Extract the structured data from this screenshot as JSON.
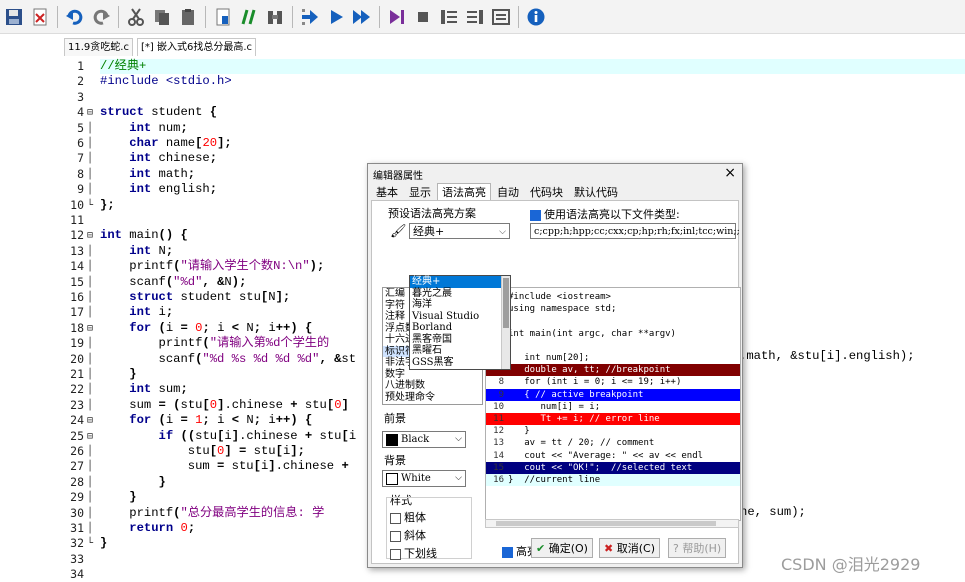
{
  "toolbar": {
    "icons": [
      "save-icon",
      "close-file-icon",
      "undo-icon",
      "redo-icon",
      "cut-icon",
      "copy-icon",
      "paste-icon",
      "new-file-icon",
      "comment-icon",
      "find-icon",
      "compile-icon",
      "run-icon",
      "compile-run-icon",
      "debug-icon",
      "stop-icon",
      "indent-icon",
      "unindent-icon",
      "format-icon",
      "about-icon"
    ],
    "colors": {
      "blue": "#1560bd",
      "green": "#1a8d2b",
      "purple": "#7a2f9a",
      "gray": "#555555",
      "red": "#cc2222"
    }
  },
  "tabs": [
    {
      "label": "11.9贪吃蛇.c"
    },
    {
      "label": "[*] 嵌入式6找总分最高.c"
    }
  ],
  "editor": {
    "line_numbers": [
      "1",
      "2",
      "3",
      "4",
      "5",
      "6",
      "7",
      "8",
      "9",
      "10",
      "11",
      "12",
      "13",
      "14",
      "15",
      "16",
      "17",
      "18",
      "19",
      "20",
      "21",
      "22",
      "23",
      "24",
      "25",
      "26",
      "27",
      "28",
      "29",
      "30",
      "31",
      "32",
      "33",
      "34"
    ],
    "current_line": 1,
    "lines": [
      "//经典+",
      "#include <stdio.h>",
      "",
      "struct student {",
      "    int num;",
      "    char name[20];",
      "    int chinese;",
      "    int math;",
      "    int english;",
      "};",
      "",
      "int main() {",
      "    int N;",
      "    printf(\"请输入学生个数N:\\n\");",
      "    scanf(\"%d\", &N);",
      "    struct student stu[N];",
      "    int i;",
      "    for (i = 0; i < N; i++) {",
      "        printf(\"请输入第%d个学生的",
      "        scanf(\"%d %s %d %d %d\", &st",
      "    }",
      "    int sum;",
      "    sum = (stu[0].chinese + stu[0]",
      "    for (i = 1; i < N; i++) {",
      "        if ((stu[i].chinese + stu[i",
      "            stu[0] = stu[i];",
      "            sum = stu[i].chinese +",
      "        }",
      "    }",
      "    printf(\"总分最高学生的信息: 学",
      "    return 0;",
      "}",
      "",
      ""
    ],
    "right_fragments": {
      "line20": ".math, &stu[i].english);",
      "line30": "ne, sum);"
    }
  },
  "dialog": {
    "title": "编辑器属性",
    "close": "×",
    "tabs": [
      "基本",
      "显示",
      "语法高亮",
      "自动",
      "代码块",
      "默认代码"
    ],
    "active_tab": "语法高亮",
    "preset_label": "预设语法高亮方案",
    "use_highlight_label": "使用语法高亮以下文件类型:",
    "file_types": "c;cpp;h;hpp;cc;cxx;cp;hp;rh;fx;inl;tcc;win;;",
    "scheme_selected": "经典+",
    "scheme_options": [
      "经典+",
      "暮光之晨",
      "海洋",
      "Visual Studio",
      "Borland",
      "黑客帝国",
      "黑曜石",
      "GSS黑客"
    ],
    "elements": [
      "汇编",
      "字符",
      "注释",
      "浮点数",
      "十六进制",
      "标识符",
      "非法字符",
      "数字",
      "八进制数",
      "预处理命令"
    ],
    "selected_element": "标识符",
    "foreground_label": "前景",
    "foreground_value": "Black",
    "background_label": "背景",
    "background_value": "White",
    "style_label": "样式",
    "style_bold": "粗体",
    "style_italic": "斜体",
    "style_underline": "下划线",
    "highlight_current_line": "高亮显示当前行",
    "preview": [
      {
        "n": "",
        "t": "#include <iostream>",
        "cls": ""
      },
      {
        "n": "",
        "t": "using namespace std;",
        "cls": ""
      },
      {
        "n": "",
        "t": "",
        "cls": ""
      },
      {
        "n": "",
        "t": "int main(int argc, char **argv)",
        "cls": ""
      },
      {
        "n": "",
        "t": "",
        "cls": ""
      },
      {
        "n": "",
        "t": "   int num[20];",
        "cls": ""
      },
      {
        "n": "",
        "t": "   double av, tt; //breakpoint",
        "cls": "bp"
      },
      {
        "n": "8",
        "t": "   for (int i = 0; i <= 19; i++)",
        "cls": ""
      },
      {
        "n": "9",
        "t": "   { // active breakpoint",
        "cls": "act"
      },
      {
        "n": "10",
        "t": "      num[i] = i;",
        "cls": ""
      },
      {
        "n": "11",
        "t": "      Tt += i; // error line",
        "cls": "err"
      },
      {
        "n": "12",
        "t": "   }",
        "cls": ""
      },
      {
        "n": "13",
        "t": "   av = tt / 20; // comment",
        "cls": ""
      },
      {
        "n": "14",
        "t": "   cout << \"Average: \" << av << endl",
        "cls": ""
      },
      {
        "n": "15",
        "t": "   cout << \"OK!\";  //selected text",
        "cls": "sel"
      },
      {
        "n": "16",
        "t": "}  //current line",
        "cls": "curl"
      }
    ],
    "buttons": {
      "ok": "确定(O)",
      "cancel": "取消(C)",
      "help": "帮助(H)"
    }
  },
  "watermark": "CSDN @泪光2929"
}
